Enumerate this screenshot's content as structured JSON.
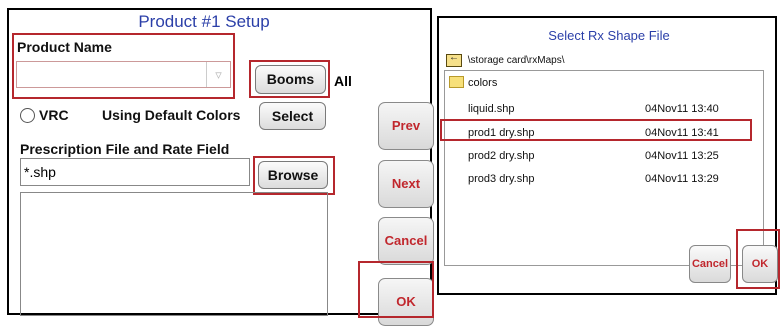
{
  "setup": {
    "title": "Product #1 Setup",
    "product_name_label": "Product Name",
    "product_name_value": "",
    "booms_label": "Booms",
    "booms_value": "All",
    "vrc_label": "VRC",
    "colors_status": "Using Default Colors",
    "select_label": "Select",
    "rx_label": "Prescription File and Rate Field",
    "rx_value": "*.shp",
    "browse_label": "Browse",
    "side_buttons": [
      "Prev",
      "Next",
      "Cancel",
      "OK"
    ]
  },
  "file_dialog": {
    "title": "Select Rx Shape File",
    "path": "\\storage card\\rxMaps\\",
    "folder": "colors",
    "files": [
      {
        "name": "liquid.shp",
        "date": "04Nov11 13:40"
      },
      {
        "name": "prod1 dry.shp",
        "date": "04Nov11 13:41",
        "selected": true
      },
      {
        "name": "prod2 dry.shp",
        "date": "04Nov11 13:25"
      },
      {
        "name": "prod3 dry.shp",
        "date": "04Nov11 13:29"
      }
    ],
    "cancel_label": "Cancel",
    "ok_label": "OK"
  },
  "colors": {
    "title": "#2b3fa8",
    "highlight": "#b5272d",
    "button_text": "#c1272d"
  }
}
